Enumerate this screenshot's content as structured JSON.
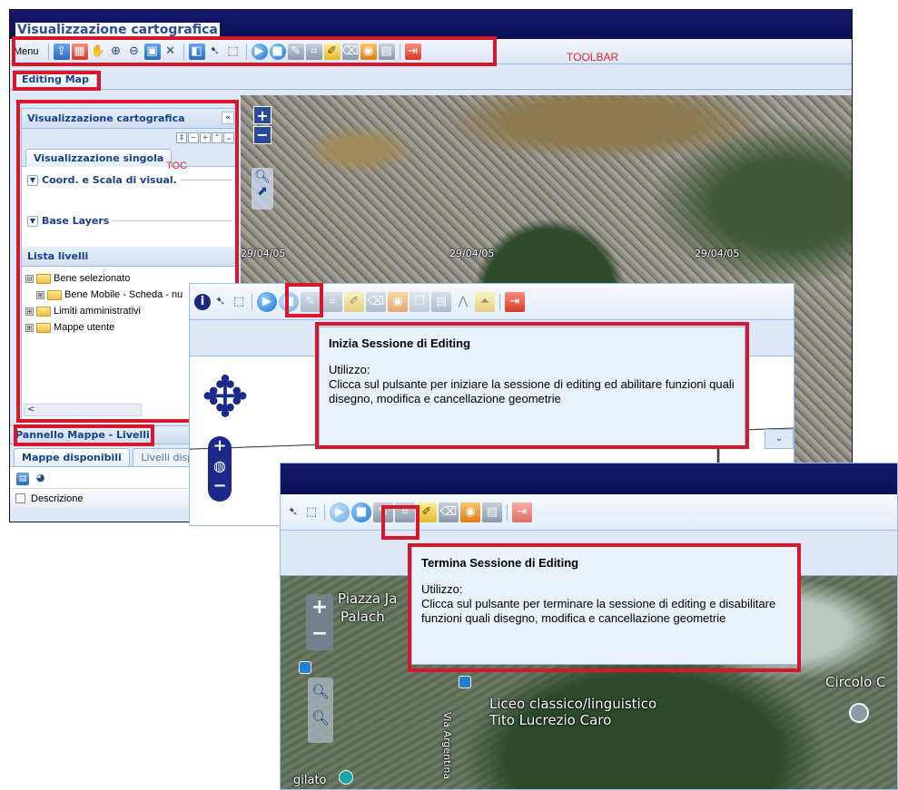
{
  "window1": {
    "app_title": "Visualizzazione cartografica",
    "toolbar": {
      "menu_label": "Menu"
    },
    "annotations": {
      "toolbar_label": "TOOLBAR",
      "toc_label": "TOC"
    },
    "tab_editing_map": "Editing Map",
    "toc": {
      "title": "Visualizzazione cartografica",
      "tab_single": "Visualizzazione singola",
      "section_coord": "Coord. e Scala di visual.",
      "section_base": "Base Layers",
      "levels_header": "Lista livelli",
      "tree": [
        {
          "label": "Bene selezionato",
          "expander": "⊟"
        },
        {
          "label": "Bene Mobile - Scheda - nu",
          "expander": "⊞"
        },
        {
          "label": "Limiti amministrativi",
          "expander": "⊞"
        },
        {
          "label": "Mappe utente",
          "expander": "⊞"
        }
      ]
    },
    "map_dates": [
      "29/04/05",
      "29/04/05",
      "29/04/05"
    ],
    "bottom_panel": {
      "title": "Pannello Mappe - Livelli",
      "tab_available_maps": "Mappe disponibili",
      "tab_available_levels": "Livelli dispo",
      "column_description": "Descrizione"
    }
  },
  "window2": {
    "tooltip": {
      "title": "Inizia Sessione di Editing",
      "usage": "Utilizzo:",
      "text": "Clicca sul pulsante per iniziare la sessione di editing ed abilitare funzioni quali disegno, modifica e cancellazione geometrie"
    }
  },
  "window3": {
    "tooltip": {
      "title": "Termina Sessione di Editing",
      "usage": "Utilizzo:",
      "text": "Clicca sul pulsante per terminare la sessione di editing e disabilitare funzioni quali disegno, modifica e cancellazione geometrie"
    },
    "map_labels": {
      "piazza": "Piazza Ja",
      "palach": "Palach",
      "liceo1": "Liceo classico/linguistico",
      "liceo2": "Tito Lucrezio Caro",
      "via": "Via Argentina",
      "circolo": "Circolo C",
      "gilato": "gilato"
    }
  }
}
